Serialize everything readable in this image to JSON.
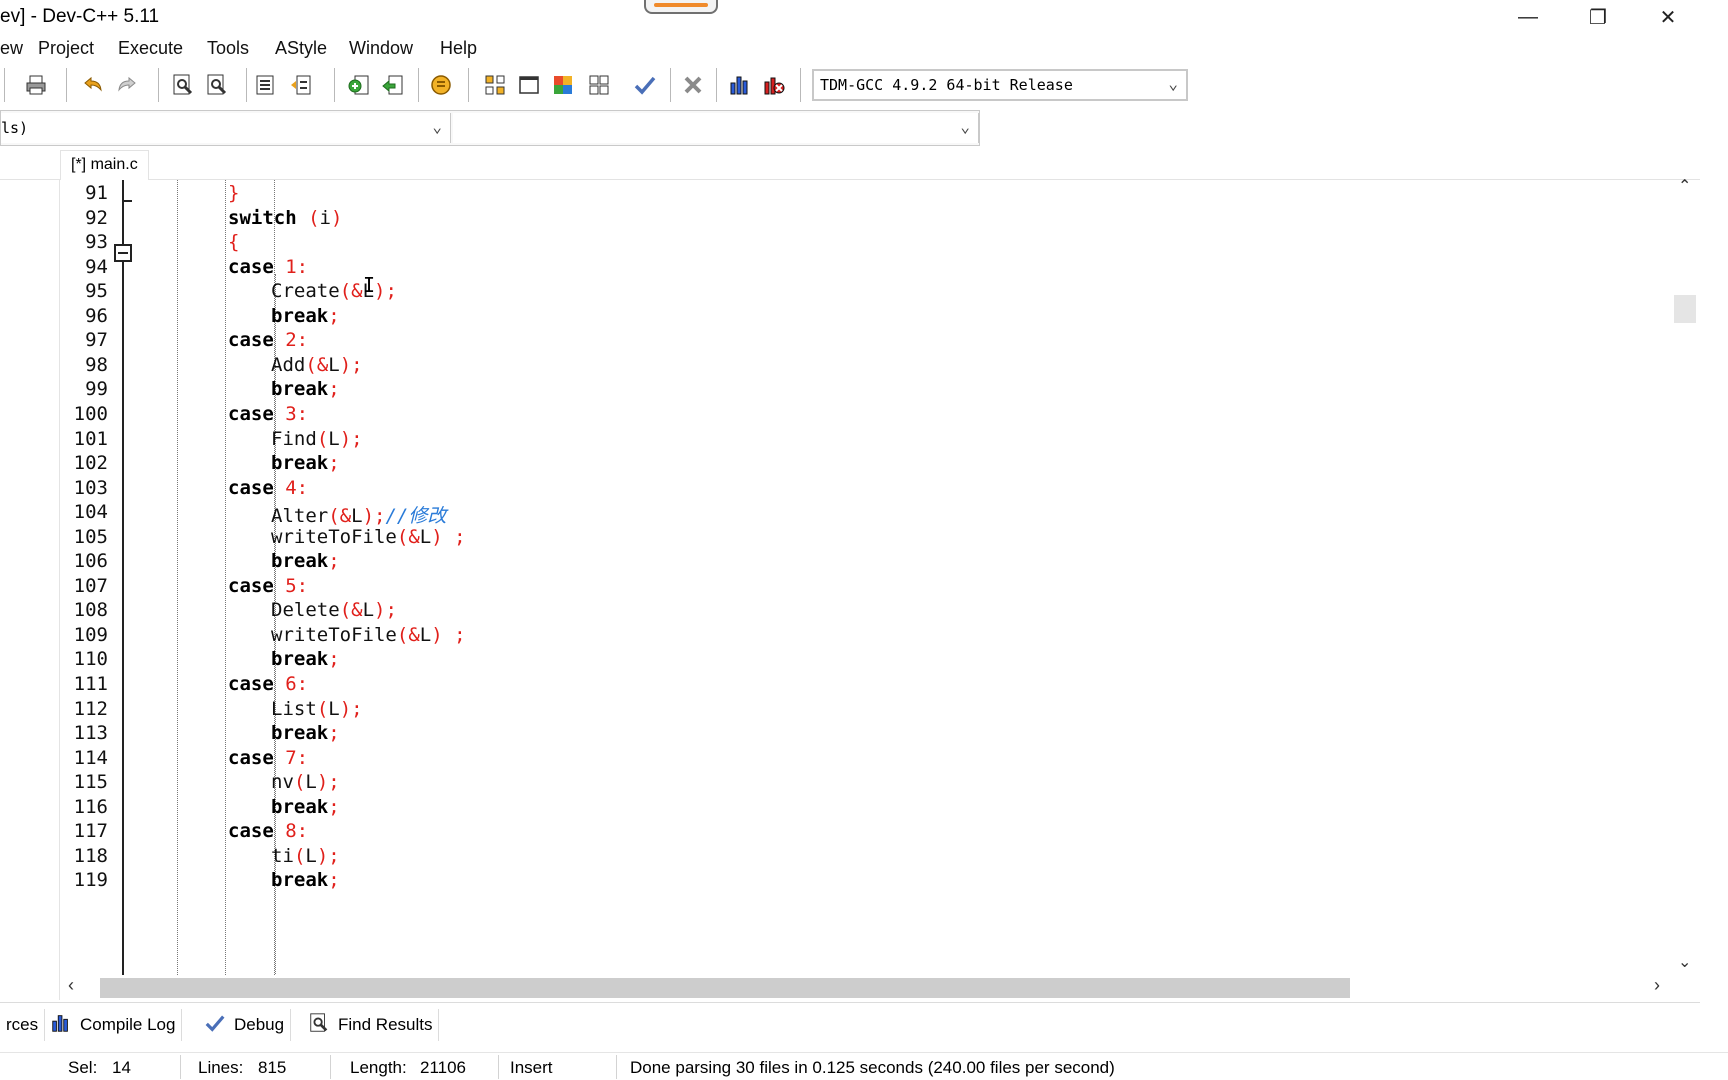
{
  "window": {
    "title": "ev] - Dev-C++ 5.11",
    "minimize_glyph": "—",
    "maximize_glyph": "❐",
    "close_glyph": "✕"
  },
  "menu": [
    "ew",
    "Project",
    "Execute",
    "Tools",
    "AStyle",
    "Window",
    "Help"
  ],
  "toolbar": {
    "compiler": "TDM-GCC 4.9.2 64-bit Release",
    "icons": [
      "print-icon",
      "undo-icon",
      "redo-icon",
      "find-icon",
      "replace-icon",
      "indent-icon",
      "unindent-icon",
      "add-to-project-icon",
      "remove-from-project-icon",
      "goto-line-icon",
      "class-browser-icon",
      "new-window-icon",
      "colors-icon",
      "layout-icon",
      "check-icon",
      "close-icon",
      "chart-icon",
      "debug-icon"
    ]
  },
  "selectors": {
    "class_value": "ls)",
    "member_value": ""
  },
  "tabs": {
    "active": "[*] main.c"
  },
  "editor": {
    "lines": [
      {
        "n": "91",
        "tokens": [
          [
            "sym",
            "}"
          ]
        ],
        "indent": 5
      },
      {
        "n": "92",
        "tokens": [
          [
            "kw",
            "switch"
          ],
          [
            "txt",
            " "
          ],
          [
            "sym",
            "("
          ],
          [
            "txt",
            "i"
          ],
          [
            "sym",
            ")"
          ]
        ],
        "indent": 5
      },
      {
        "n": "93",
        "tokens": [
          [
            "sym",
            "{"
          ]
        ],
        "indent": 5
      },
      {
        "n": "94",
        "tokens": [
          [
            "kw",
            "case"
          ],
          [
            "txt",
            " "
          ],
          [
            "num",
            "1"
          ],
          [
            "sym",
            ":"
          ]
        ],
        "indent": 5
      },
      {
        "n": "95",
        "tokens": [
          [
            "txt",
            "Create"
          ],
          [
            "sym",
            "(&"
          ],
          [
            "txt",
            "L"
          ],
          [
            "sym",
            ");"
          ]
        ],
        "indent": 7
      },
      {
        "n": "96",
        "tokens": [
          [
            "kw",
            "break"
          ],
          [
            "sym",
            ";"
          ]
        ],
        "indent": 7
      },
      {
        "n": "97",
        "tokens": [
          [
            "kw",
            "case"
          ],
          [
            "txt",
            " "
          ],
          [
            "num",
            "2"
          ],
          [
            "sym",
            ":"
          ]
        ],
        "indent": 5
      },
      {
        "n": "98",
        "tokens": [
          [
            "txt",
            "Add"
          ],
          [
            "sym",
            "(&"
          ],
          [
            "txt",
            "L"
          ],
          [
            "sym",
            ");"
          ]
        ],
        "indent": 7
      },
      {
        "n": "99",
        "tokens": [
          [
            "kw",
            "break"
          ],
          [
            "sym",
            ";"
          ]
        ],
        "indent": 7
      },
      {
        "n": "100",
        "tokens": [
          [
            "kw",
            "case"
          ],
          [
            "txt",
            " "
          ],
          [
            "num",
            "3"
          ],
          [
            "sym",
            ":"
          ]
        ],
        "indent": 5
      },
      {
        "n": "101",
        "tokens": [
          [
            "txt",
            "Find"
          ],
          [
            "sym",
            "("
          ],
          [
            "txt",
            "L"
          ],
          [
            "sym",
            ");"
          ]
        ],
        "indent": 7
      },
      {
        "n": "102",
        "tokens": [
          [
            "kw",
            "break"
          ],
          [
            "sym",
            ";"
          ]
        ],
        "indent": 7
      },
      {
        "n": "103",
        "tokens": [
          [
            "kw",
            "case"
          ],
          [
            "txt",
            " "
          ],
          [
            "num",
            "4"
          ],
          [
            "sym",
            ":"
          ]
        ],
        "indent": 5
      },
      {
        "n": "104",
        "tokens": [
          [
            "txt",
            "Alter"
          ],
          [
            "sym",
            "(&"
          ],
          [
            "txt",
            "L"
          ],
          [
            "sym",
            ");"
          ],
          [
            "cmt",
            "//修改"
          ]
        ],
        "indent": 7
      },
      {
        "n": "105",
        "tokens": [
          [
            "txt",
            "writeToFile"
          ],
          [
            "sym",
            "(&"
          ],
          [
            "txt",
            "L"
          ],
          [
            "sym",
            ")"
          ],
          [
            "txt",
            " "
          ],
          [
            "sym",
            ";"
          ]
        ],
        "indent": 7
      },
      {
        "n": "106",
        "tokens": [
          [
            "kw",
            "break"
          ],
          [
            "sym",
            ";"
          ]
        ],
        "indent": 7
      },
      {
        "n": "107",
        "tokens": [
          [
            "kw",
            "case"
          ],
          [
            "txt",
            " "
          ],
          [
            "num",
            "5"
          ],
          [
            "sym",
            ":"
          ]
        ],
        "indent": 5
      },
      {
        "n": "108",
        "tokens": [
          [
            "txt",
            "Delete"
          ],
          [
            "sym",
            "(&"
          ],
          [
            "txt",
            "L"
          ],
          [
            "sym",
            ");"
          ]
        ],
        "indent": 7
      },
      {
        "n": "109",
        "tokens": [
          [
            "txt",
            "writeToFile"
          ],
          [
            "sym",
            "(&"
          ],
          [
            "txt",
            "L"
          ],
          [
            "sym",
            ")"
          ],
          [
            "txt",
            " "
          ],
          [
            "sym",
            ";"
          ]
        ],
        "indent": 7
      },
      {
        "n": "110",
        "tokens": [
          [
            "kw",
            "break"
          ],
          [
            "sym",
            ";"
          ]
        ],
        "indent": 7
      },
      {
        "n": "111",
        "tokens": [
          [
            "kw",
            "case"
          ],
          [
            "txt",
            " "
          ],
          [
            "num",
            "6"
          ],
          [
            "sym",
            ":"
          ]
        ],
        "indent": 5
      },
      {
        "n": "112",
        "tokens": [
          [
            "txt",
            "List"
          ],
          [
            "sym",
            "("
          ],
          [
            "txt",
            "L"
          ],
          [
            "sym",
            ");"
          ]
        ],
        "indent": 7
      },
      {
        "n": "113",
        "tokens": [
          [
            "kw",
            "break"
          ],
          [
            "sym",
            ";"
          ]
        ],
        "indent": 7
      },
      {
        "n": "114",
        "tokens": [
          [
            "kw",
            "case"
          ],
          [
            "txt",
            " "
          ],
          [
            "num",
            "7"
          ],
          [
            "sym",
            ":"
          ]
        ],
        "indent": 5
      },
      {
        "n": "115",
        "tokens": [
          [
            "txt",
            "nv"
          ],
          [
            "sym",
            "("
          ],
          [
            "txt",
            "L"
          ],
          [
            "sym",
            ");"
          ]
        ],
        "indent": 7
      },
      {
        "n": "116",
        "tokens": [
          [
            "kw",
            "break"
          ],
          [
            "sym",
            ";"
          ]
        ],
        "indent": 7
      },
      {
        "n": "117",
        "tokens": [
          [
            "kw",
            "case"
          ],
          [
            "txt",
            " "
          ],
          [
            "num",
            "8"
          ],
          [
            "sym",
            ":"
          ]
        ],
        "indent": 5
      },
      {
        "n": "118",
        "tokens": [
          [
            "txt",
            "ti"
          ],
          [
            "sym",
            "("
          ],
          [
            "txt",
            "L"
          ],
          [
            "sym",
            ");"
          ]
        ],
        "indent": 7
      },
      {
        "n": "119",
        "tokens": [
          [
            "kw",
            "break"
          ],
          [
            "sym",
            ";"
          ]
        ],
        "indent": 7
      }
    ],
    "cursor_glyph": "I"
  },
  "bottom_tabs": {
    "resources": "rces",
    "compile_log": "Compile Log",
    "debug": "Debug",
    "find_results": "Find Results"
  },
  "status": {
    "sel_label": "Sel:",
    "sel_value": "14",
    "lines_label": "Lines:",
    "lines_value": "815",
    "length_label": "Length:",
    "length_value": "21106",
    "mode": "Insert",
    "message": "Done parsing 30 files in 0.125 seconds (240.00 files per second)"
  },
  "colors": {
    "keyword": "#000000",
    "symbol": "#e0201b",
    "comment": "#2a7bd8",
    "accent": "#f08a2a"
  }
}
